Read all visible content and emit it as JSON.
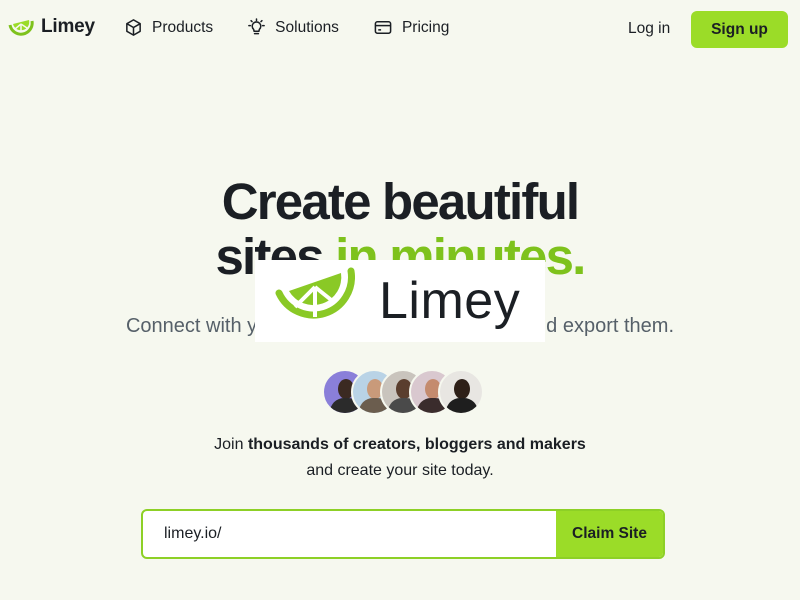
{
  "nav": {
    "brand": "Limey",
    "links": [
      {
        "label": "Products",
        "icon": "cube-icon"
      },
      {
        "label": "Solutions",
        "icon": "lightbulb-icon"
      },
      {
        "label": "Pricing",
        "icon": "credit-card-icon"
      }
    ],
    "login": "Log in",
    "signup": "Sign up"
  },
  "hero": {
    "headline_line1": "Create beautiful",
    "headline_line2_dark": "sites ",
    "headline_line2_accent": "in minutes.",
    "subtitle": "Connect with your favorite tools, create sites and export them."
  },
  "watermark": {
    "text": "Limey"
  },
  "social_proof": {
    "avatars": [
      {
        "name": "avatar-1",
        "bg": "#8a7fd9"
      },
      {
        "name": "avatar-2",
        "bg": "#b9d3e6"
      },
      {
        "name": "avatar-3",
        "bg": "#c9c4bd"
      },
      {
        "name": "avatar-4",
        "bg": "#d9c8cf"
      },
      {
        "name": "avatar-5",
        "bg": "#e8e6e2"
      }
    ],
    "join_prefix": "Join ",
    "join_bold": "thousands of creators, bloggers and makers",
    "join_line2": "and create your site today."
  },
  "claim": {
    "value": "limey.io/",
    "button": "Claim Site"
  },
  "colors": {
    "accent": "#9bdc28",
    "accent_text": "#7ec21c",
    "background": "#f6f8ef",
    "text": "#1b1f24"
  }
}
